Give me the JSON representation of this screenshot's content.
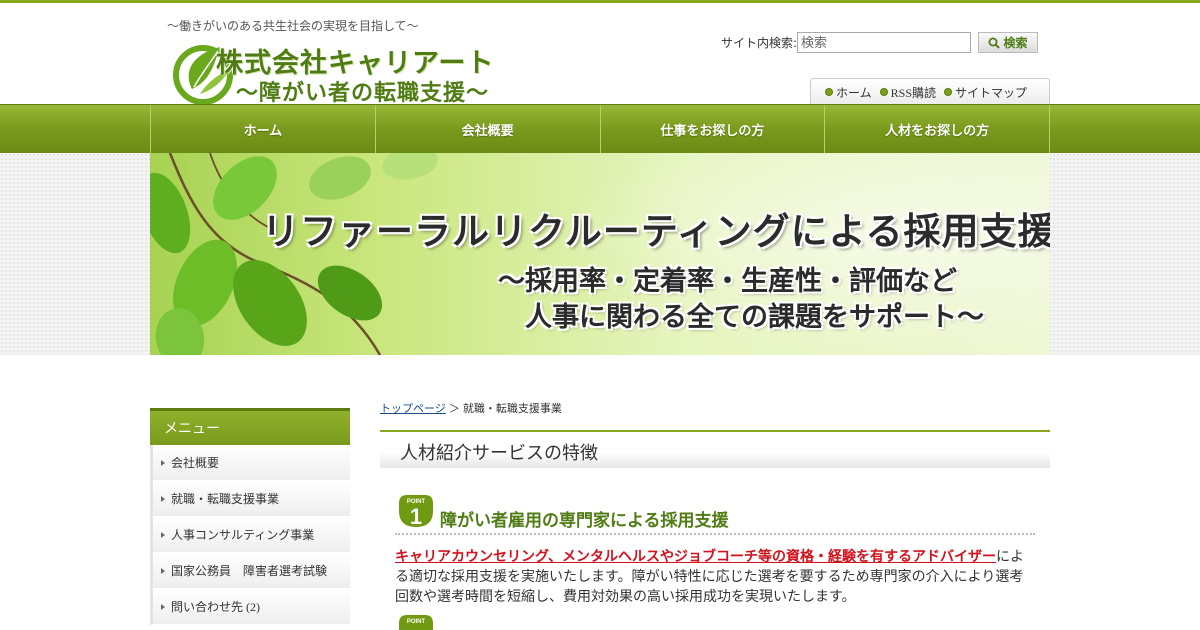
{
  "header": {
    "tagline": "～働きがいのある共生社会の実現を目指して～",
    "logo_line1": "株式会社キャリアート",
    "logo_line2": "～障がい者の転職支援～",
    "search_label": "サイト内検索:",
    "search_placeholder": "検索",
    "search_button": "検索",
    "util_links": [
      "ホーム",
      "RSS購読",
      "サイトマップ"
    ]
  },
  "nav": {
    "items": [
      "ホーム",
      "会社概要",
      "仕事をお探しの方",
      "人材をお探しの方"
    ]
  },
  "banner": {
    "title": "リファーラルリクルーティングによる採用支援",
    "sub1": "～採用率・定着率・生産性・評価など",
    "sub2": "人事に関わる全ての課題をサポート～"
  },
  "sidebar": {
    "title": "メニュー",
    "items": [
      "会社概要",
      "就職・転職支援事業",
      "人事コンサルティング事業",
      "国家公務員　障害者選考試験",
      "問い合わせ先 (2)"
    ]
  },
  "breadcrumb": {
    "home": "トップページ",
    "separator": "＞",
    "current": "就職・転職支援事業"
  },
  "main": {
    "section_title": "人材紹介サービスの特徴",
    "point1_badge_top": "POINT",
    "point1_badge_num": "1",
    "point2_badge_top": "POINT",
    "point1_heading": "障がい者雇用の専門家による採用支援",
    "point1_highlight": "キャリアカウンセリング、メンタルヘルスやジョブコーチ等の資格・経験を有するアドバイザー",
    "point1_text": "による適切な採用支援を実施いたします。障がい特性に応じた選考を要するため専門家の介入により選考回数や選考時間を短縮し、費用対効果の高い採用成功を実現いたします。"
  },
  "colors": {
    "accent": "#86a81a",
    "brand_text": "#4f7d14",
    "highlight": "#d4111c"
  }
}
